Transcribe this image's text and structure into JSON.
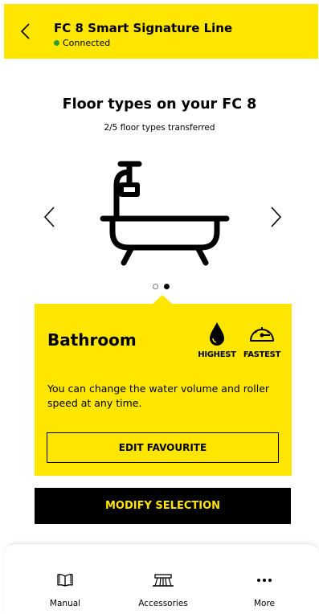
{
  "header": {
    "title": "FC 8 Smart Signature Line",
    "status": "Connected",
    "status_color": "#2f9e3a",
    "back_icon": "chevron-left-icon"
  },
  "main": {
    "title": "Floor types on your FC 8",
    "subtitle": "2/5 floor types transferred",
    "carousel": {
      "image_icon": "bathtub-icon",
      "prev_icon": "chevron-left-icon",
      "next_icon": "chevron-right-icon",
      "page_count": 2,
      "active_page": 2
    }
  },
  "card": {
    "title": "Bathroom",
    "water_label": "HIGHEST",
    "water_icon": "water-drop-icon",
    "speed_label": "FASTEST",
    "speed_icon": "speedometer-icon",
    "description": "You can change the water volume and roller speed at any time.",
    "edit_label": "EDIT FAVOURITE"
  },
  "modify_label": "MODIFY SELECTION",
  "bottom_nav": {
    "manual": "Manual",
    "accessories": "Accessories",
    "more": "More"
  },
  "colors": {
    "accent": "#ffe600",
    "dark": "#000000"
  }
}
